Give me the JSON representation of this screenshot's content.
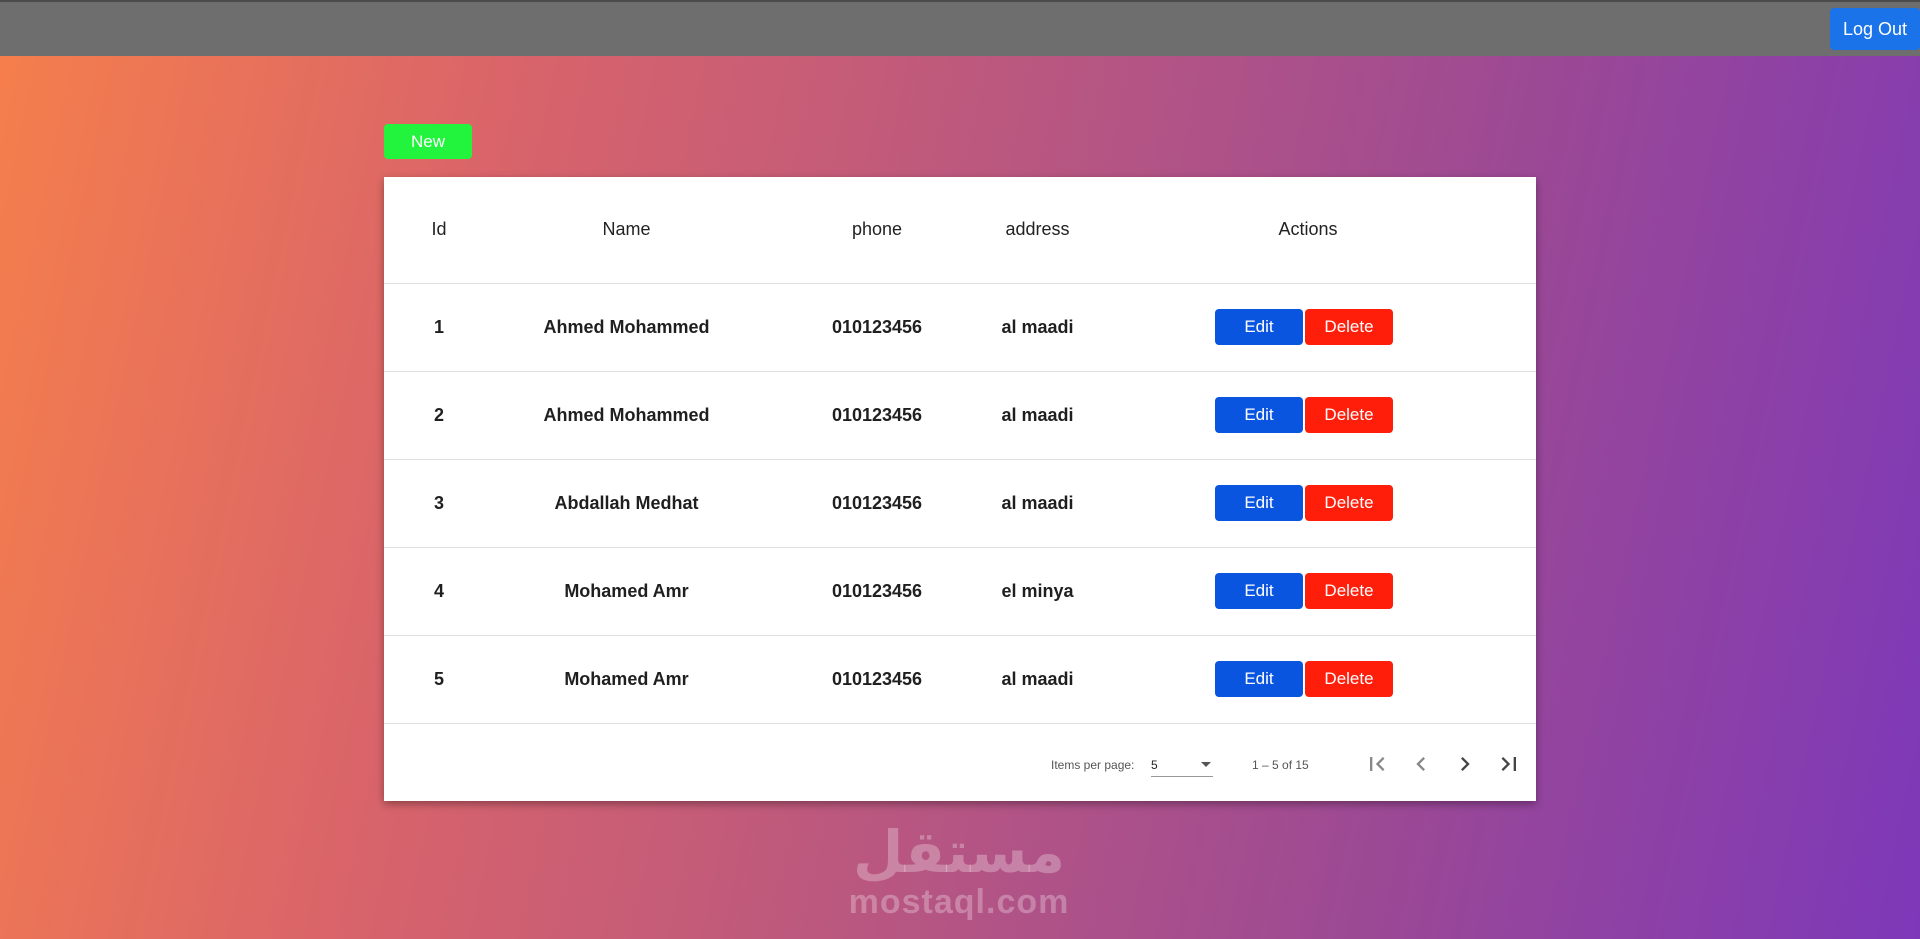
{
  "header": {
    "logout_label": "Log Out"
  },
  "toolbar": {
    "new_label": "New"
  },
  "table": {
    "columns": {
      "id": "Id",
      "name": "Name",
      "phone": "phone",
      "address": "address",
      "actions": "Actions"
    },
    "rows": [
      {
        "id": "1",
        "name": "Ahmed Mohammed",
        "phone": "010123456",
        "address": "al maadi",
        "edit": "Edit",
        "delete": "Delete"
      },
      {
        "id": "2",
        "name": "Ahmed Mohammed",
        "phone": "010123456",
        "address": "al maadi",
        "edit": "Edit",
        "delete": "Delete"
      },
      {
        "id": "3",
        "name": "Abdallah Medhat",
        "phone": "010123456",
        "address": "al maadi",
        "edit": "Edit",
        "delete": "Delete"
      },
      {
        "id": "4",
        "name": "Mohamed Amr",
        "phone": "010123456",
        "address": "el minya",
        "edit": "Edit",
        "delete": "Delete"
      },
      {
        "id": "5",
        "name": "Mohamed Amr",
        "phone": "010123456",
        "address": "al maadi",
        "edit": "Edit",
        "delete": "Delete"
      }
    ]
  },
  "paginator": {
    "items_per_page_label": "Items per page:",
    "items_per_page_value": "5",
    "range_label": "1 – 5 of 15",
    "icons": [
      "first-page-icon",
      "previous-page-icon",
      "next-page-icon",
      "last-page-icon"
    ]
  },
  "watermark": {
    "arabic": "مستقل",
    "latin": "mostaql.com"
  },
  "colors": {
    "topbar": "#6e6e6e",
    "logout": "#1a73e8",
    "new": "#22f33c",
    "edit": "#0a55e0",
    "delete": "#ff1e0a"
  }
}
